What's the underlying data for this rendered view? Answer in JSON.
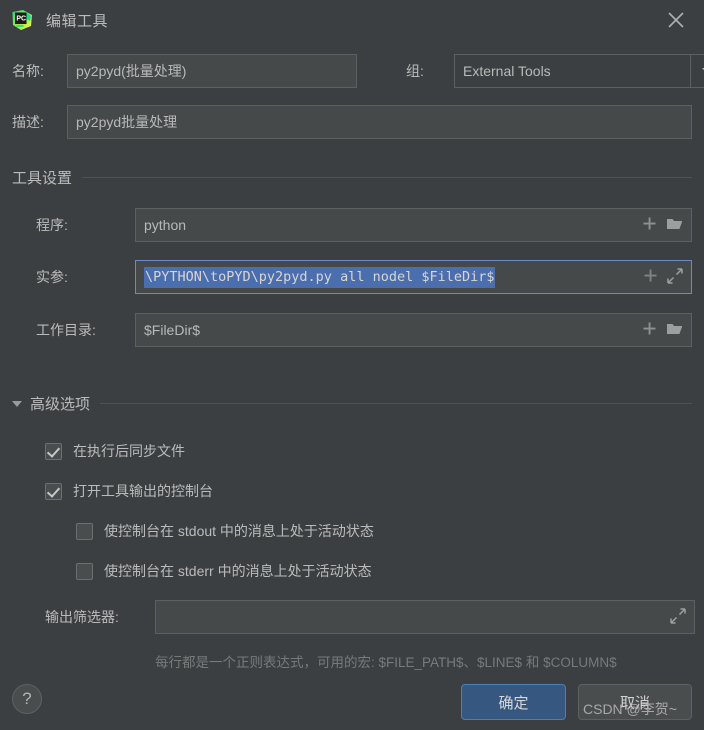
{
  "window": {
    "title": "编辑工具",
    "app_icon": "pycharm-icon",
    "close_icon": "close-icon"
  },
  "form": {
    "name_label": "名称:",
    "name_value": "py2pyd(批量处理)",
    "group_label": "组:",
    "group_value": "External Tools",
    "group_options": [
      "External Tools"
    ],
    "description_label": "描述:",
    "description_value": "py2pyd批量处理"
  },
  "tool_settings": {
    "section_title": "工具设置",
    "program_label": "程序:",
    "program_value": "python",
    "arguments_label": "实参:",
    "arguments_value": "\\PYTHON\\toPYD\\py2pyd.py all nodel $FileDir$",
    "working_dir_label": "工作目录:",
    "working_dir_value": "$FileDir$",
    "insert_macro_icon": "plus-icon",
    "browse_icon": "folder-icon",
    "expand_icon": "expand-arrows-icon"
  },
  "advanced": {
    "section_title": "高级选项",
    "collapse_icon": "chevron-down-icon",
    "checkboxes": [
      {
        "label": "在执行后同步文件",
        "checked": true,
        "indented": false
      },
      {
        "label": "打开工具输出的控制台",
        "checked": true,
        "indented": false
      },
      {
        "label": "使控制台在 stdout 中的消息上处于活动状态",
        "checked": false,
        "indented": true
      },
      {
        "label": "使控制台在 stderr 中的消息上处于活动状态",
        "checked": false,
        "indented": true
      }
    ],
    "output_filter_label": "输出筛选器:",
    "output_filter_value": "",
    "output_filter_expand_icon": "expand-arrows-icon",
    "hint": "每行都是一个正则表达式，可用的宏: $FILE_PATH$、$LINE$ 和 $COLUMN$"
  },
  "footer": {
    "help_label": "?",
    "ok_label": "确定",
    "cancel_label": "取消",
    "watermark": "CSDN @李贺~"
  },
  "colors": {
    "dialog_bg": "#3c3f41",
    "field_bg": "#45494a",
    "border": "#5e6060",
    "text": "#bbbbbb",
    "selection_bg": "#4b6eaf",
    "ok_button_bg": "#365880",
    "hint_text": "#777a7b"
  }
}
